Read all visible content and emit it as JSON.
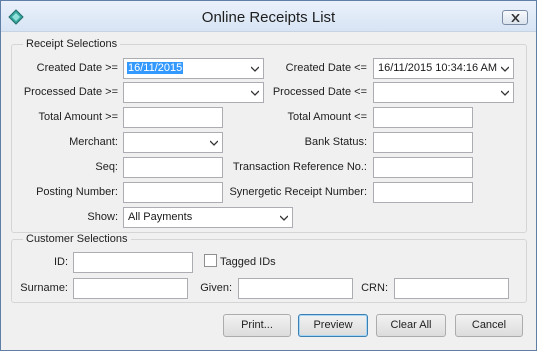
{
  "window": {
    "title": "Online Receipts List",
    "close_label": "×"
  },
  "receipt": {
    "legend": "Receipt Selections",
    "created_from_label": "Created Date >=",
    "created_from_value": "16/11/2015",
    "created_to_label": "Created Date <=",
    "created_to_value": "16/11/2015 10:34:16 AM",
    "processed_from_label": "Processed Date >=",
    "processed_from_value": "",
    "processed_to_label": "Processed Date <=",
    "processed_to_value": "",
    "total_from_label": "Total Amount >=",
    "total_to_label": "Total Amount <=",
    "merchant_label": "Merchant:",
    "merchant_value": "",
    "bank_status_label": "Bank Status:",
    "seq_label": "Seq:",
    "txn_ref_label": "Transaction Reference No.:",
    "posting_label": "Posting Number:",
    "synergetic_label": "Synergetic Receipt Number:",
    "show_label": "Show:",
    "show_value": "All Payments"
  },
  "customer": {
    "legend": "Customer Selections",
    "id_label": "ID:",
    "tagged_label": "Tagged IDs",
    "surname_label": "Surname:",
    "given_label": "Given:",
    "crn_label": "CRN:"
  },
  "buttons": {
    "print": "Print...",
    "preview": "Preview",
    "clear": "Clear All",
    "cancel": "Cancel"
  },
  "icons": {
    "app": "app-diamond-icon",
    "close": "close-icon",
    "dropdown": "chevron-down-icon"
  }
}
